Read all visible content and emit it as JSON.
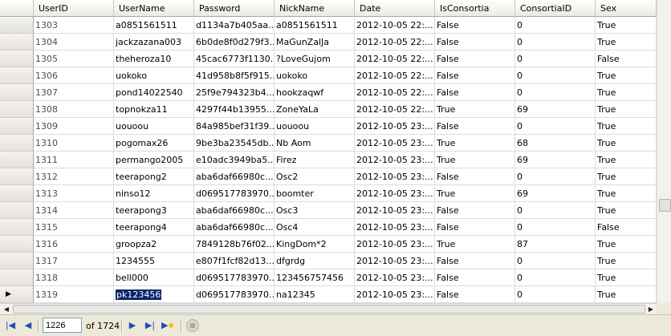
{
  "grid": {
    "columns": [
      "UserID",
      "UserName",
      "Password",
      "NickName",
      "Date",
      "IsConsortia",
      "ConsortiaID",
      "Sex"
    ],
    "rows": [
      [
        "1303",
        "a0851561511",
        "d1134a7b405aa...",
        "a0851561511",
        "2012-10-05 22:...",
        "False",
        "0",
        "True"
      ],
      [
        "1304",
        "jackzazana003",
        "6b0de8f0d279f3...",
        "MaGunZalJa",
        "2012-10-05 22:...",
        "False",
        "0",
        "True"
      ],
      [
        "1305",
        "theheroza10",
        "45cac6773f1130...",
        "?LoveGujom",
        "2012-10-05 22:...",
        "False",
        "0",
        "False"
      ],
      [
        "1306",
        "uokoko",
        "41d958b8f5f915...",
        "uokoko",
        "2012-10-05 22:...",
        "False",
        "0",
        "True"
      ],
      [
        "1307",
        "pond14022540",
        "25f9e794323b4...",
        "hookzaqwf",
        "2012-10-05 22:...",
        "False",
        "0",
        "True"
      ],
      [
        "1308",
        "topnokza11",
        "4297f44b13955...",
        "ZoneYaLa",
        "2012-10-05 22:...",
        "True",
        "69",
        "True"
      ],
      [
        "1309",
        "uouoou",
        "84a985bef31f39...",
        "uouoou",
        "2012-10-05 23:...",
        "False",
        "0",
        "True"
      ],
      [
        "1310",
        "pogomax26",
        "9be3ba23545db...",
        "Nb Aom",
        "2012-10-05 23:...",
        "True",
        "68",
        "True"
      ],
      [
        "1311",
        "permango2005",
        "e10adc3949ba5...",
        "Firez",
        "2012-10-05 23:...",
        "True",
        "69",
        "True"
      ],
      [
        "1312",
        "teerapong2",
        "aba6daf66980c...",
        "Osc2",
        "2012-10-05 23:...",
        "False",
        "0",
        "True"
      ],
      [
        "1313",
        "ninso12",
        "d069517783970...",
        "boomter",
        "2012-10-05 23:...",
        "True",
        "69",
        "True"
      ],
      [
        "1314",
        "teerapong3",
        "aba6daf66980c...",
        "Osc3",
        "2012-10-05 23:...",
        "False",
        "0",
        "True"
      ],
      [
        "1315",
        "teerapong4",
        "aba6daf66980c...",
        "Osc4",
        "2012-10-05 23:...",
        "False",
        "0",
        "False"
      ],
      [
        "1316",
        "groopza2",
        "7849128b76f02...",
        "KingDom*2",
        "2012-10-05 23:...",
        "True",
        "87",
        "True"
      ],
      [
        "1317",
        "1234555",
        "e807f1fcf82d13...",
        "dfgrdg",
        "2012-10-05 23:...",
        "False",
        "0",
        "True"
      ],
      [
        "1318",
        "bell000",
        "d069517783970...",
        "123456757456",
        "2012-10-05 23:...",
        "False",
        "0",
        "True"
      ],
      [
        "1319",
        "pk123456",
        "d069517783970...",
        "na12345",
        "2012-10-05 23:...",
        "False",
        "0",
        "True"
      ]
    ],
    "current_row_index": 16,
    "selected_cell_column": 1
  },
  "navigator": {
    "position_value": "1226",
    "of_label": "of 1724",
    "icons": [
      "move-first-icon",
      "move-previous-icon",
      "move-next-icon",
      "move-last-icon",
      "add-new-icon",
      "stop-icon"
    ]
  }
}
